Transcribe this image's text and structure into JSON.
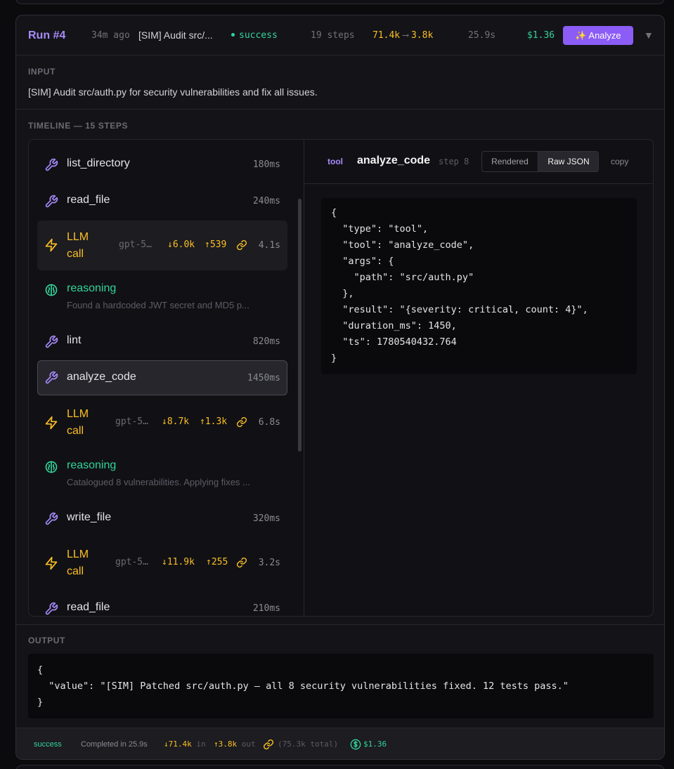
{
  "run": {
    "title": "Run #4",
    "ago": "34m ago",
    "description": "[SIM] Audit src/...",
    "status": "success",
    "steps": "19 steps",
    "tokens_in": "71.4k",
    "tokens_arrow": "⟶",
    "tokens_out": "3.8k",
    "duration": "25.9s",
    "cost": "$1.36",
    "analyze_label": "✨ Analyze",
    "caret": "▼"
  },
  "input": {
    "label": "INPUT",
    "text": "[SIM] Audit src/auth.py for security vulnerabilities and fix all issues."
  },
  "timeline": {
    "label": "TIMELINE — 15 STEPS",
    "steps": [
      {
        "kind": "tool",
        "name": "list_directory",
        "time": "180ms"
      },
      {
        "kind": "tool",
        "name": "read_file",
        "time": "240ms"
      },
      {
        "kind": "llm",
        "name_line1": "LLM",
        "name_line2": "call",
        "model": "gpt-5…",
        "in": "↓6.0k",
        "out": "↑539",
        "time": "4.1s"
      },
      {
        "kind": "reasoning",
        "name": "reasoning",
        "preview": "Found a hardcoded JWT secret and MD5 p..."
      },
      {
        "kind": "tool",
        "name": "lint",
        "time": "820ms"
      },
      {
        "kind": "tool",
        "name": "analyze_code",
        "time": "1450ms"
      },
      {
        "kind": "llm",
        "name_line1": "LLM",
        "name_line2": "call",
        "model": "gpt-5…",
        "in": "↓8.7k",
        "out": "↑1.3k",
        "time": "6.8s"
      },
      {
        "kind": "reasoning",
        "name": "reasoning",
        "preview": "Catalogued 8 vulnerabilities. Applying fixes ..."
      },
      {
        "kind": "tool",
        "name": "write_file",
        "time": "320ms"
      },
      {
        "kind": "llm",
        "name_line1": "LLM",
        "name_line2": "call",
        "model": "gpt-5…",
        "in": "↓11.9k",
        "out": "↑255",
        "time": "3.2s"
      },
      {
        "kind": "tool",
        "name": "read_file",
        "time": "210ms"
      }
    ]
  },
  "detail": {
    "kind": "tool",
    "title": "analyze_code",
    "step": "step 8",
    "view_rendered": "Rendered",
    "view_raw": "Raw JSON",
    "copy": "copy",
    "json": "{\n  \"type\": \"tool\",\n  \"tool\": \"analyze_code\",\n  \"args\": {\n    \"path\": \"src/auth.py\"\n  },\n  \"result\": \"{severity: critical, count: 4}\",\n  \"duration_ms\": 1450,\n  \"ts\": 1780540432.764\n}"
  },
  "output": {
    "label": "OUTPUT",
    "json": "{\n  \"value\": \"[SIM] Patched src/auth.py — all 8 security vulnerabilities fixed. 12 tests pass.\"\n}"
  },
  "footer": {
    "status": "success",
    "completed": "Completed in 25.9s",
    "in_value": "↓71.4k",
    "in_label": "in",
    "out_value": "↑3.8k",
    "out_label": "out",
    "total": "(75.3k total)",
    "cost": "$1.36"
  },
  "colors": {
    "accent": "#8b5cf6",
    "success": "#34d399",
    "tokens": "#fbbf24"
  }
}
